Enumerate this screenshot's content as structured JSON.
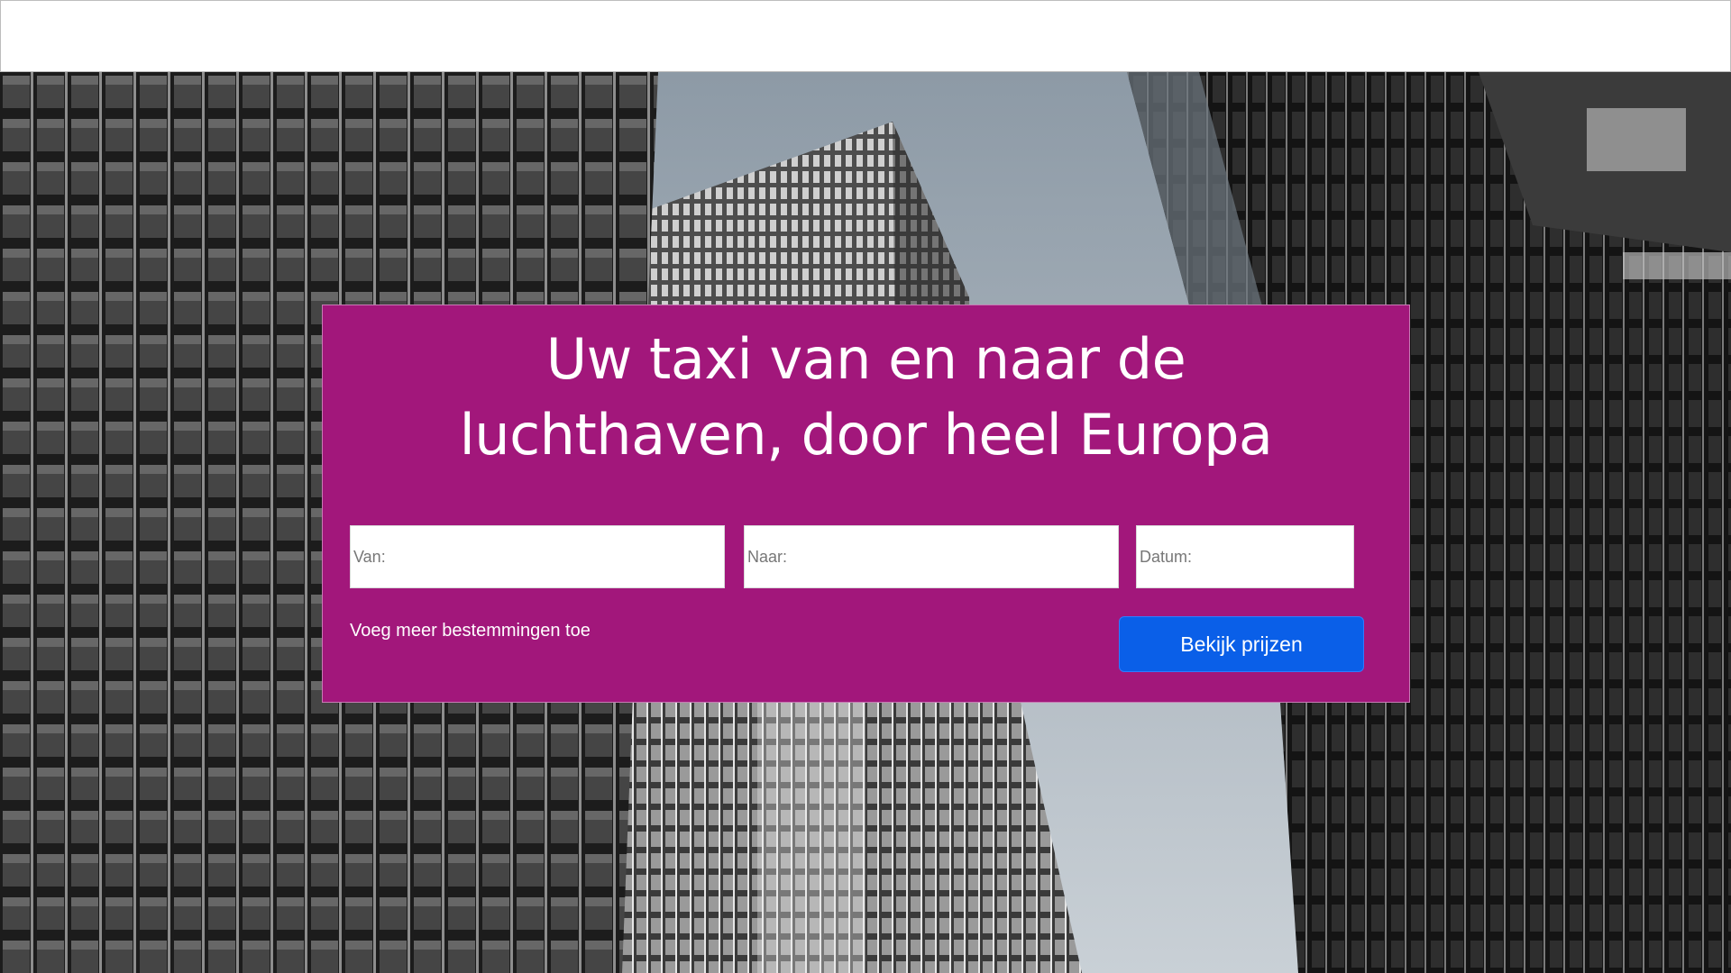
{
  "hero": {
    "headline_line1": "Uw taxi van en naar de",
    "headline_line2": "luchthaven, door heel Europa"
  },
  "form": {
    "from_placeholder": "Van:",
    "to_placeholder": "Naar:",
    "date_placeholder": "Datum:",
    "add_destinations_label": "Voeg meer bestemmingen toe",
    "submit_label": "Bekijk prijzen"
  },
  "colors": {
    "panel_background": "#a2177b",
    "button_background": "#0a5fe8",
    "text_on_panel": "#ffffff"
  }
}
